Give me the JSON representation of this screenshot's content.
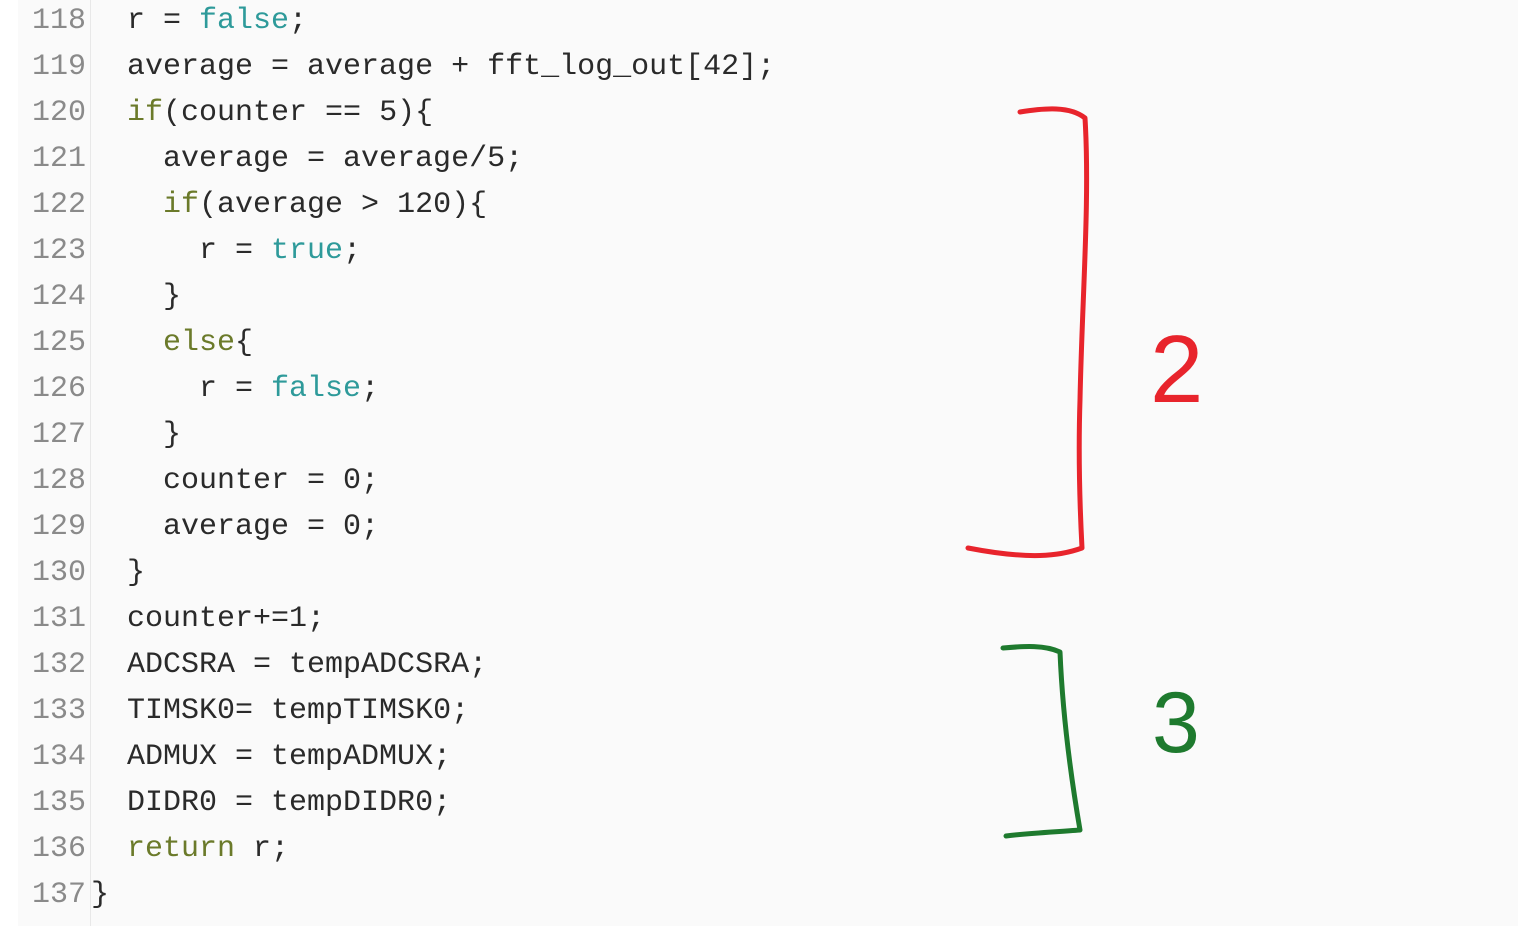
{
  "editor": {
    "lines": [
      {
        "num": "118",
        "indent": "  ",
        "tokens": [
          {
            "t": "r = ",
            "c": "plain"
          },
          {
            "t": "false",
            "c": "lit"
          },
          {
            "t": ";",
            "c": "plain"
          }
        ]
      },
      {
        "num": "119",
        "indent": "  ",
        "tokens": [
          {
            "t": "average = average + fft_log_out[42];",
            "c": "plain"
          }
        ]
      },
      {
        "num": "120",
        "indent": "  ",
        "tokens": [
          {
            "t": "if",
            "c": "kw"
          },
          {
            "t": "(counter == 5){",
            "c": "plain"
          }
        ]
      },
      {
        "num": "121",
        "indent": "    ",
        "tokens": [
          {
            "t": "average = average/5;",
            "c": "plain"
          }
        ]
      },
      {
        "num": "122",
        "indent": "    ",
        "tokens": [
          {
            "t": "if",
            "c": "kw"
          },
          {
            "t": "(average > 120){",
            "c": "plain"
          }
        ]
      },
      {
        "num": "123",
        "indent": "      ",
        "tokens": [
          {
            "t": "r = ",
            "c": "plain"
          },
          {
            "t": "true",
            "c": "lit"
          },
          {
            "t": ";",
            "c": "plain"
          }
        ]
      },
      {
        "num": "124",
        "indent": "    ",
        "tokens": [
          {
            "t": "}",
            "c": "plain"
          }
        ]
      },
      {
        "num": "125",
        "indent": "    ",
        "tokens": [
          {
            "t": "else",
            "c": "kw"
          },
          {
            "t": "{",
            "c": "plain"
          }
        ]
      },
      {
        "num": "126",
        "indent": "      ",
        "tokens": [
          {
            "t": "r = ",
            "c": "plain"
          },
          {
            "t": "false",
            "c": "lit"
          },
          {
            "t": ";",
            "c": "plain"
          }
        ]
      },
      {
        "num": "127",
        "indent": "    ",
        "tokens": [
          {
            "t": "}",
            "c": "plain"
          }
        ]
      },
      {
        "num": "128",
        "indent": "    ",
        "tokens": [
          {
            "t": "counter = 0;",
            "c": "plain"
          }
        ]
      },
      {
        "num": "129",
        "indent": "    ",
        "tokens": [
          {
            "t": "average = 0;",
            "c": "plain"
          }
        ]
      },
      {
        "num": "130",
        "indent": "  ",
        "tokens": [
          {
            "t": "}",
            "c": "plain"
          }
        ]
      },
      {
        "num": "131",
        "indent": "  ",
        "tokens": [
          {
            "t": "counter+=1;",
            "c": "plain"
          }
        ]
      },
      {
        "num": "132",
        "indent": "  ",
        "tokens": [
          {
            "t": "ADCSRA = tempADCSRA;",
            "c": "plain"
          }
        ]
      },
      {
        "num": "133",
        "indent": "  ",
        "tokens": [
          {
            "t": "TIMSK0= tempTIMSK0;",
            "c": "plain"
          }
        ]
      },
      {
        "num": "134",
        "indent": "  ",
        "tokens": [
          {
            "t": "ADMUX = tempADMUX;",
            "c": "plain"
          }
        ]
      },
      {
        "num": "135",
        "indent": "  ",
        "tokens": [
          {
            "t": "DIDR0 = tempDIDR0;",
            "c": "plain"
          }
        ]
      },
      {
        "num": "136",
        "indent": "  ",
        "tokens": [
          {
            "t": "return",
            "c": "kw"
          },
          {
            "t": " r;",
            "c": "plain"
          }
        ]
      },
      {
        "num": "137",
        "indent": "",
        "tokens": [
          {
            "t": "}",
            "c": "plain"
          }
        ]
      }
    ]
  },
  "annotations": {
    "red_label": "2",
    "green_label": "3",
    "red_color": "#e8242c",
    "green_color": "#1e7a2e"
  },
  "colors": {
    "keyword": "#6b7a2a",
    "literal": "#2e9a9a",
    "text": "#2a2a2a",
    "line_number": "#8a8a8a"
  }
}
